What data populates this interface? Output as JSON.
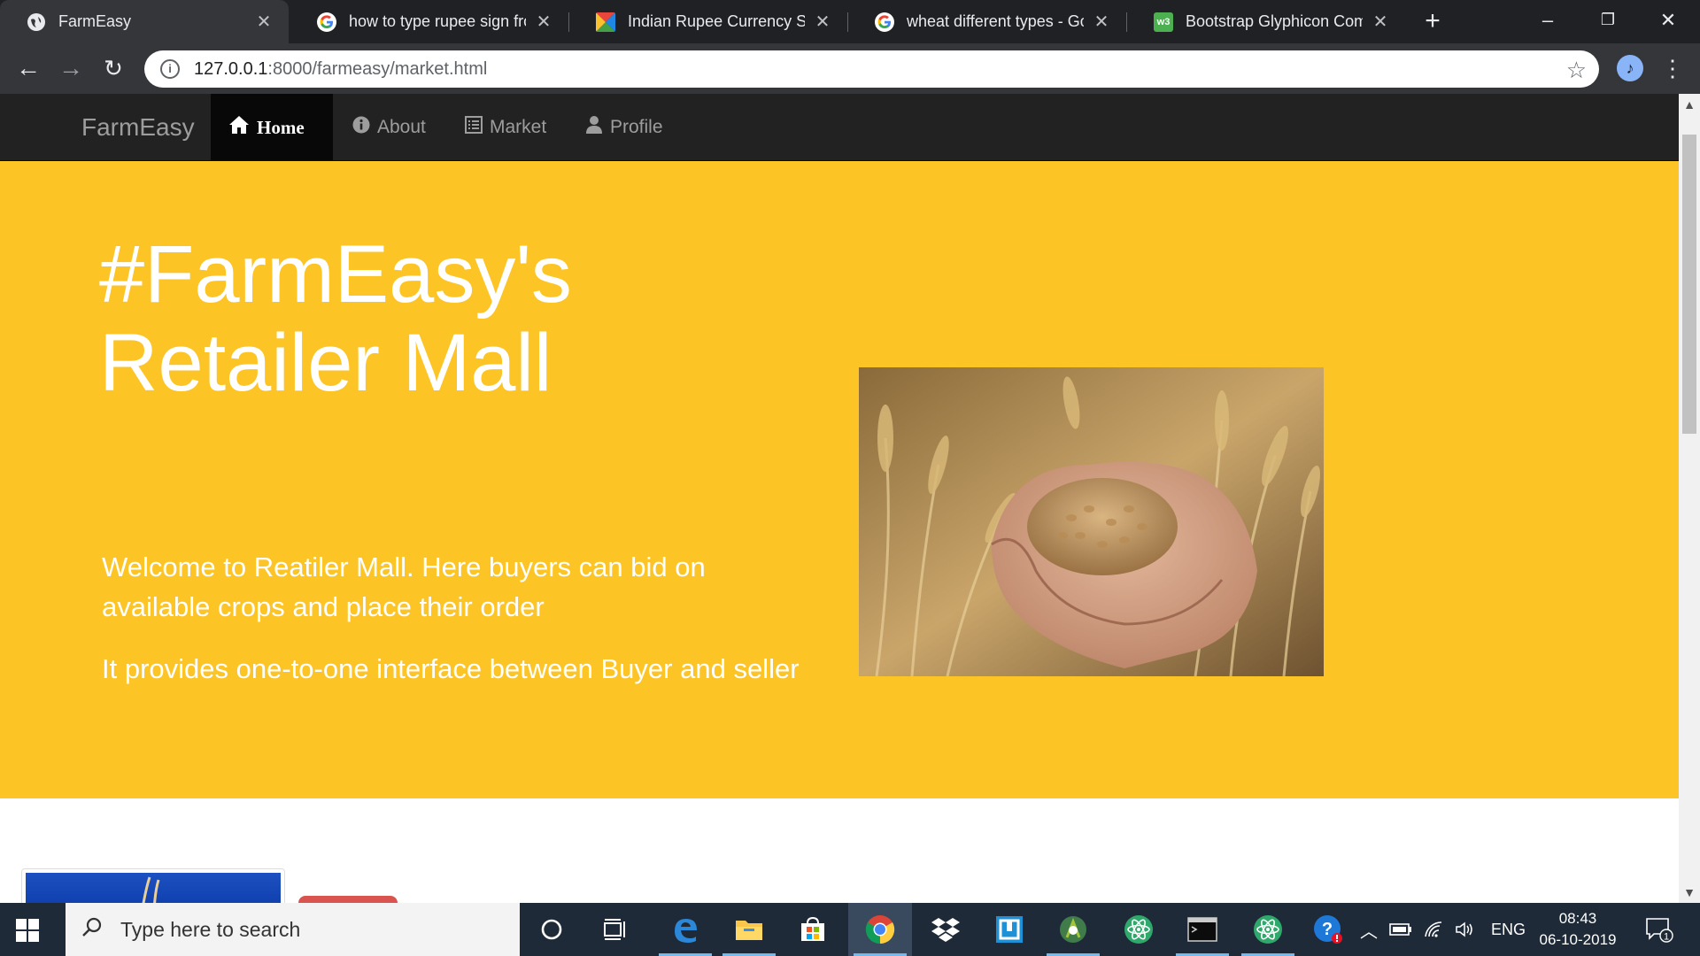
{
  "browser": {
    "tabs": [
      {
        "title": "FarmEasy",
        "favicon": "globe-icon",
        "active": true
      },
      {
        "title": "how to type rupee sign fron",
        "favicon": "google-icon",
        "active": false
      },
      {
        "title": "Indian Rupee Currency Sym",
        "favicon": "flag-icon",
        "active": false
      },
      {
        "title": "wheat different types - Goo",
        "favicon": "google-icon",
        "active": false
      },
      {
        "title": "Bootstrap Glyphicon Comp",
        "favicon": "w3-icon",
        "active": false
      }
    ],
    "url_host": "127.0.0.1",
    "url_path": ":8000/farmeasy/market.html"
  },
  "navbar": {
    "brand": "FarmEasy",
    "items": [
      {
        "label": "Home",
        "icon": "home-icon",
        "active": true
      },
      {
        "label": "About",
        "icon": "info-sign-icon",
        "active": false
      },
      {
        "label": "Market",
        "icon": "list-alt-icon",
        "active": false
      },
      {
        "label": "Profile",
        "icon": "user-icon",
        "active": false
      }
    ]
  },
  "hero": {
    "title_line1": "#FarmEasy's",
    "title_line2": "Retailer Mall",
    "paragraph1": "Welcome to Reatiler Mall. Here buyers can bid on available crops and place their order",
    "paragraph2": "It provides one-to-one interface between Buyer and seller",
    "image": "hands holding wheat grains in a wheat field"
  },
  "taskbar": {
    "search_placeholder": "Type here to search",
    "language": "ENG",
    "time": "08:43",
    "date": "06-10-2019",
    "notification_count": "1"
  },
  "colors": {
    "jumbotron": "#fdc426",
    "navbar": "#222222",
    "taskbar": "#1f2a38"
  }
}
